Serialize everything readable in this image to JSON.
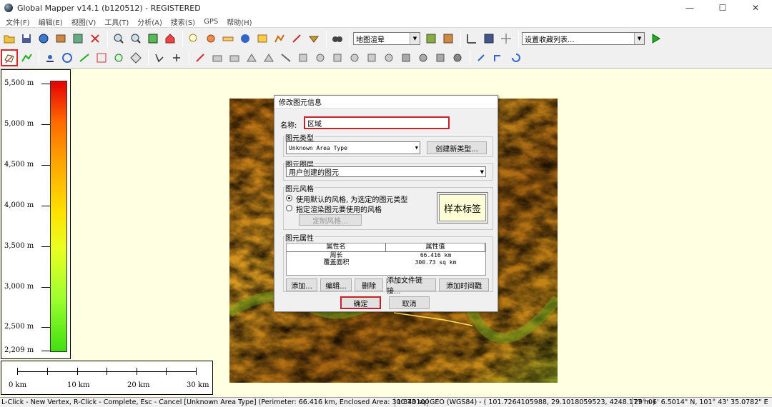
{
  "window": {
    "title": "Global Mapper v14.1 (b120512) - REGISTERED",
    "minimize": "—",
    "maximize": "☐",
    "close": "✕"
  },
  "menu": [
    "文件(F)",
    "编辑(E)",
    "视图(V)",
    "工具(T)",
    "分析(A)",
    "搜索(S)",
    "GPS",
    "帮助(H)"
  ],
  "toolbar": {
    "render_combo": "地图渲晕",
    "bookmark_combo": "设置收藏列表..."
  },
  "legend": {
    "labels": [
      "5,500 m",
      "5,000 m",
      "4,500 m",
      "4,000 m",
      "3,500 m",
      "3,000 m",
      "2,500 m",
      "2,209 m"
    ],
    "colors": [
      "#e60000",
      "#ff6a00",
      "#ffa500",
      "#ffe000",
      "#a0ff30",
      "#40e010"
    ]
  },
  "scale": {
    "labels": [
      "0 km",
      "10 km",
      "20 km",
      "30 km"
    ]
  },
  "dialog": {
    "title": "修改图元信息",
    "name_label": "名称:",
    "name_value": "区域",
    "type_group": "图元类型",
    "type_value": "Unknown Area Type",
    "create_type_btn": "创建新类型...",
    "layer_group": "图元图层",
    "layer_value": "用户创建的图元",
    "style_group": "图元风格",
    "style_opt1": "使用默认的风格, 为选定的图元类型",
    "style_opt2": "指定渲染图元要使用的风格",
    "custom_style_btn": "定制风格...",
    "sample_label": "样本标签",
    "attr_group": "图元属性",
    "attr_col_name": "属性名",
    "attr_col_value": "属性值",
    "attributes": [
      {
        "name": "周长",
        "value": "66.416 km"
      },
      {
        "name": "覆盖面积",
        "value": "300.73 sq km"
      }
    ],
    "add_btn": "添加...",
    "edit_btn": "编辑...",
    "delete_btn": "删除",
    "add_link_btn": "添加文件链接...",
    "add_time_btn": "添加时间戳",
    "ok_btn": "确定",
    "cancel_btn": "取消"
  },
  "status": {
    "hint": "L-Click - New Vertex, R-Click - Complete, Esc - Cancel [Unknown Area Type] (Perimeter: 66.416 km, Enclosed Area: 300.73 sq",
    "scale": "1:340100",
    "coords": "GEO (WGS84) - ( 101.7264105988, 29.1018059523, 4248.177 m )",
    "dms": "29° 06' 6.5014\" N, 101° 43' 35.0782\" E"
  }
}
